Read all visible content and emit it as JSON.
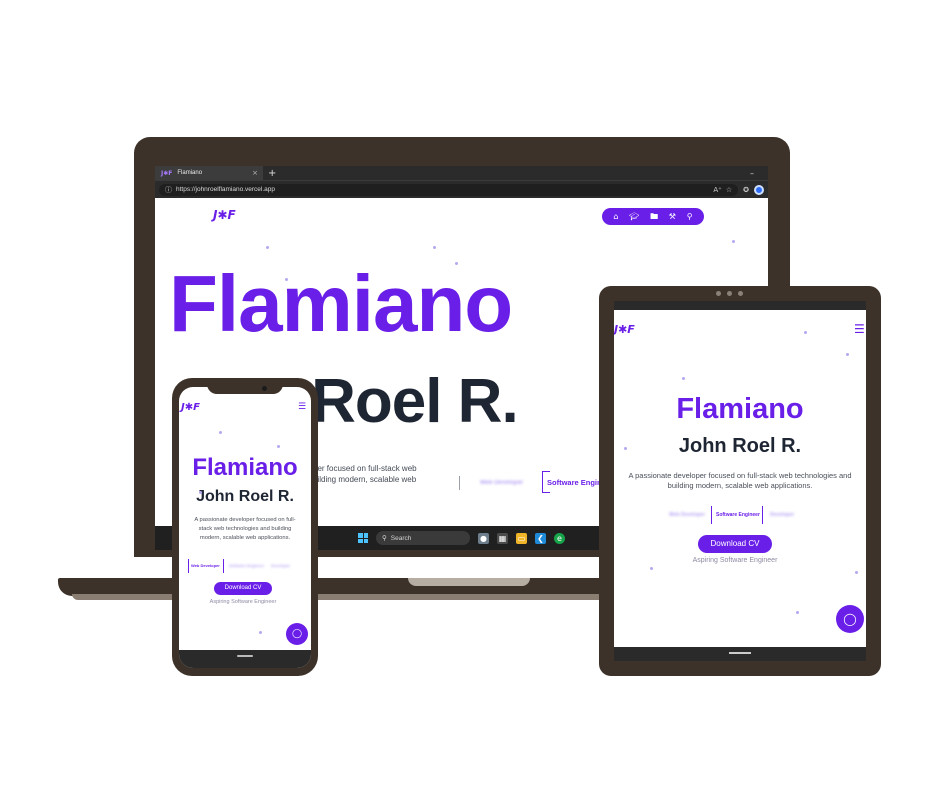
{
  "browser": {
    "tab_title": "Flamiano",
    "tab_favicon": "J✱F",
    "tab_close": "×",
    "new_tab": "+",
    "minimize": "–",
    "url": "https://johnroelflamiano.vercel.app"
  },
  "site": {
    "logo": "J✱F",
    "nav_icons": [
      "home-icon",
      "graduation-cap-icon",
      "folder-icon",
      "tools-icon",
      "location-pin-icon"
    ],
    "first_name": "Flamiano",
    "full_name": "John Roel R.",
    "laptop_name_partial": "n Roel R.",
    "laptop_tagline": "per focused on full-stack web\nuilding modern, scalable web",
    "tagline": "A passionate developer focused on full-stack web technologies and building modern, scalable web applications.",
    "roles": [
      "Web Developer",
      "Software Engineer",
      "Developer"
    ],
    "download_cv": "Download CV",
    "aspiring": "Aspiring Software Engineer"
  },
  "taskbar": {
    "search_placeholder": "Search"
  },
  "colors": {
    "brand_purple": "#6a1fe8",
    "heading_dark": "#1e2533",
    "device_frame": "#3d3229"
  }
}
